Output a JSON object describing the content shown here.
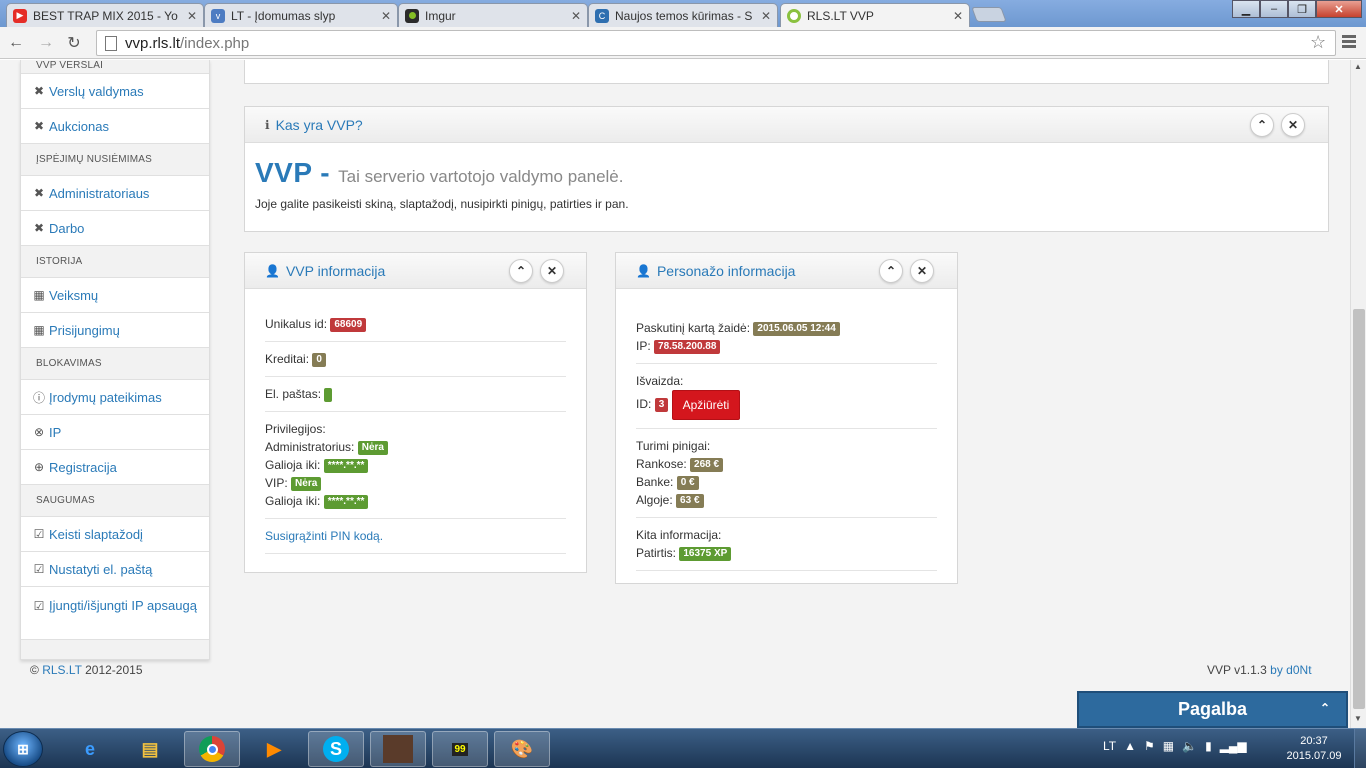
{
  "browser": {
    "tabs": [
      {
        "title": "BEST TRAP MIX 2015 - Yo",
        "icon": "youtube-icon",
        "color": "#e52d27"
      },
      {
        "title": "LT - Įdomumas slyp",
        "icon": "vbulletin-icon",
        "color": "#4d7cc2"
      },
      {
        "title": "Imgur",
        "icon": "imgur-icon",
        "color": "#2b2b2b"
      },
      {
        "title": "Naujos temos kūrimas - S",
        "icon": "forum-icon",
        "color": "#2e6fb0"
      },
      {
        "title": "RLS.LT VVP",
        "icon": "rls-icon",
        "color": "#8ac13f"
      }
    ],
    "url_host": "vvp.rls.lt",
    "url_path": "/index.php"
  },
  "sidebar": {
    "sections": [
      {
        "header": "VVP VERSLAI",
        "items": [
          {
            "label": "Verslų valdymas",
            "icon": "x-icon",
            "glyph": "✖"
          },
          {
            "label": "Aukcionas",
            "icon": "x-icon",
            "glyph": "✖"
          }
        ]
      },
      {
        "header": "ĮSPĖJIMŲ NUSIĖMIMAS",
        "items": [
          {
            "label": "Administratoriaus",
            "icon": "x-icon",
            "glyph": "✖"
          },
          {
            "label": "Darbo",
            "icon": "x-icon",
            "glyph": "✖"
          }
        ]
      },
      {
        "header": "ISTORIJA",
        "items": [
          {
            "label": "Veiksmų",
            "icon": "calendar-icon",
            "glyph": "▦"
          },
          {
            "label": "Prisijungimų",
            "icon": "calendar-icon",
            "glyph": "▦"
          }
        ]
      },
      {
        "header": "BLOKAVIMAS",
        "items": [
          {
            "label": "Įrodymų pateikimas",
            "icon": "info-circle-icon",
            "glyph": "ⓘ"
          },
          {
            "label": "IP",
            "icon": "circle-x-icon",
            "glyph": "⊗"
          },
          {
            "label": "Registracija",
            "icon": "circle-plus-icon",
            "glyph": "⊕"
          }
        ]
      },
      {
        "header": "SAUGUMAS",
        "items": [
          {
            "label": "Keisti slaptažodį",
            "icon": "edit-check-icon",
            "glyph": "☑"
          },
          {
            "label": "Nustatyti el. paštą",
            "icon": "edit-check-icon",
            "glyph": "☑"
          },
          {
            "label": "Įjungti/išjungti IP apsaugą",
            "icon": "edit-check-icon",
            "glyph": "☑"
          }
        ]
      }
    ]
  },
  "about": {
    "title": "Kas yra VVP?",
    "big": "VVP -",
    "subtitle": "Tai serverio vartotojo valdymo panelė.",
    "desc": "Joje galite pasikeisti skiną, slaptažodį, nusipirkti pinigų, patirties ir pan."
  },
  "vvp_info": {
    "title": "VVP informacija",
    "unique_id_label": "Unikalus id:",
    "unique_id": "68609",
    "credits_label": "Kreditai:",
    "credits": "0",
    "email_label": "El. paštas:",
    "email": "",
    "privileges_label": "Privilegijos:",
    "admin_label": "Administratorius:",
    "admin_value": "Nėra",
    "valid_label": "Galioja iki:",
    "admin_valid": "****.**.**",
    "vip_label": "VIP:",
    "vip_value": "Nėra",
    "vip_valid": "****.**.**",
    "pin_link": "Susigrąžinti PIN kodą."
  },
  "character_info": {
    "title": "Personažo informacija",
    "last_played_label": "Paskutinį kartą žaidė:",
    "last_played": "2015.06.05 12:44",
    "ip_label": "IP:",
    "ip": "78.58.200.88",
    "appearance_label": "Išvaizda:",
    "id_label": "ID:",
    "id": "3",
    "view_button": "Apžiūrėti",
    "money_label": "Turimi pinigai:",
    "hands_label": "Rankose:",
    "hands": "268 €",
    "bank_label": "Banke:",
    "bank": "0 €",
    "algoje_label": "Algoje:",
    "algoje": "63 €",
    "other_label": "Kita informacija:",
    "xp_label": "Patirtis:",
    "xp": "16375 XP"
  },
  "footer": {
    "copyright_symbol": "©",
    "brand": "RLS.LT",
    "years": "2012-2015",
    "version": "VVP v1.1.3",
    "by": "by d0Nt"
  },
  "help_button": "Pagalba",
  "taskbar": {
    "lang": "LT",
    "time": "20:37",
    "date": "2015.07.09"
  }
}
